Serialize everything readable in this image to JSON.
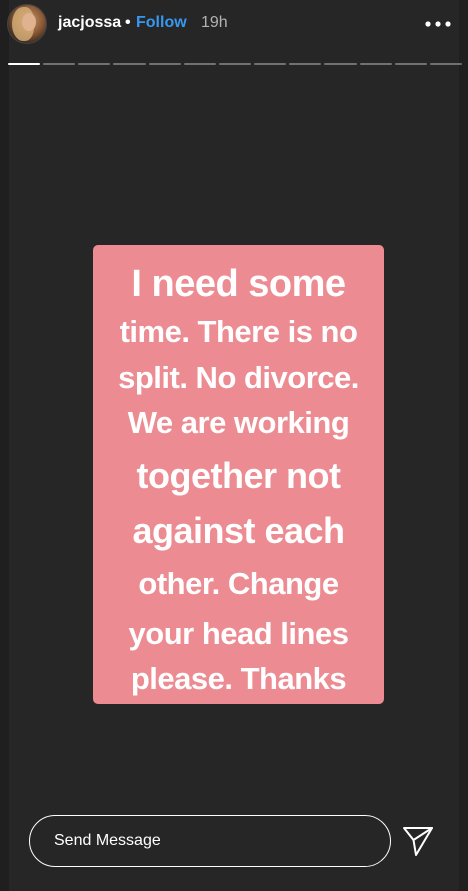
{
  "header": {
    "username": "jacjossa",
    "separator": "•",
    "follow_label": "Follow",
    "time_ago": "19h",
    "more_icon": "more-horizontal-icon"
  },
  "progress": {
    "segments": 13,
    "active_index": 0
  },
  "card": {
    "background": "#ec8c92",
    "lines": [
      "I need some",
      "time. There is no",
      "split. No divorce.",
      "We are working",
      "together not",
      "against each",
      "other. Change",
      "your head lines",
      "please. Thanks"
    ]
  },
  "footer": {
    "message_placeholder": "Send Message",
    "send_icon": "send-icon"
  },
  "colors": {
    "accent": "#3897f0",
    "background": "#262626"
  }
}
